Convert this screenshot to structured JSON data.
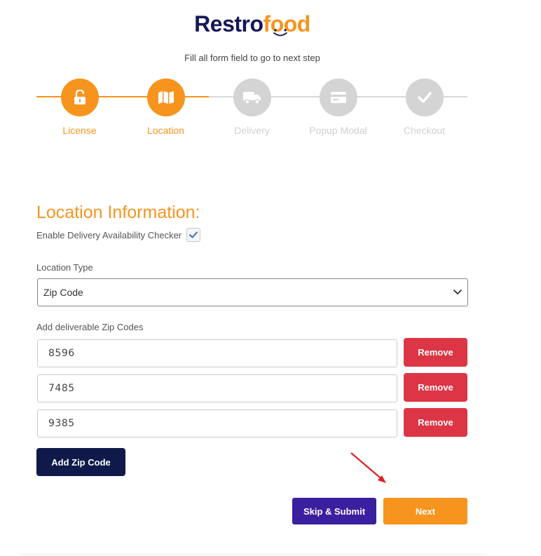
{
  "brand": {
    "part1": "Restro",
    "part2": "food"
  },
  "subtitle": "Fill all form field to go to next step",
  "steps": [
    {
      "label": "License",
      "icon": "unlock-icon",
      "state": "active"
    },
    {
      "label": "Location",
      "icon": "map-icon",
      "state": "active"
    },
    {
      "label": "Delivery",
      "icon": "truck-icon",
      "state": "inactive"
    },
    {
      "label": "Popup Modal",
      "icon": "card-icon",
      "state": "inactive"
    },
    {
      "label": "Checkout",
      "icon": "check-icon",
      "state": "inactive"
    }
  ],
  "section": {
    "title": "Location Information:",
    "delivery_checker_label": "Enable Delivery Availability Checker",
    "delivery_checker_checked": true,
    "location_type_label": "Location Type",
    "location_type_value": "Zip Code",
    "zip_codes_label": "Add deliverable Zip Codes"
  },
  "zip_codes": [
    {
      "value": "8596",
      "remove_label": "Remove"
    },
    {
      "value": "7485",
      "remove_label": "Remove"
    },
    {
      "value": "9385",
      "remove_label": "Remove"
    }
  ],
  "buttons": {
    "add_zip": "Add Zip Code",
    "skip_submit": "Skip & Submit",
    "next": "Next"
  },
  "colors": {
    "accent": "#f7941d",
    "brand_dark": "#14185a",
    "danger": "#dc3545",
    "add_button": "#0f1a4a",
    "skip_button": "#3a1f9e",
    "inactive": "#d4d4d4",
    "annotation_arrow": "#e02020"
  }
}
